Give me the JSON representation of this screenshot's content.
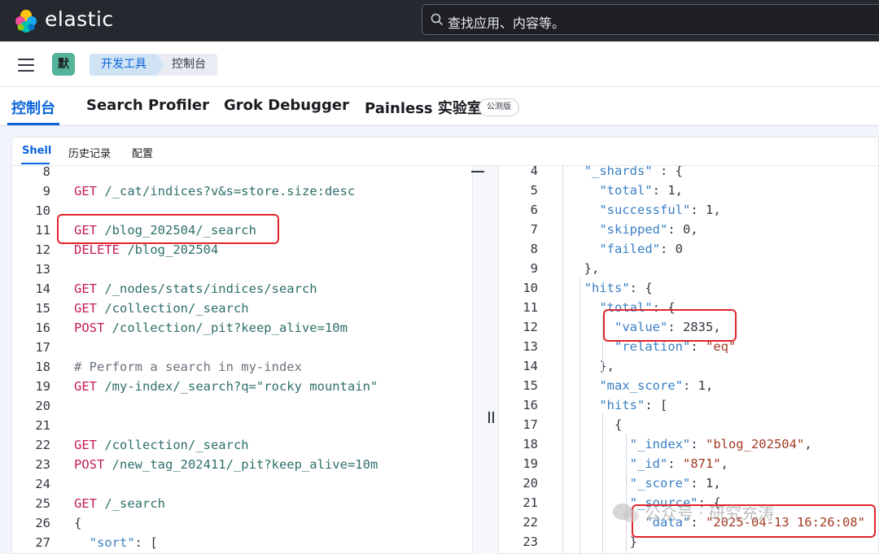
{
  "header": {
    "brand": "elastic",
    "search_placeholder": "查找应用、内容等。"
  },
  "breadcrumb": {
    "avatar_initial": "默",
    "items": [
      "开发工具",
      "控制台"
    ]
  },
  "tabs": [
    "控制台",
    "Search Profiler",
    "Grok Debugger",
    "Painless 实验室"
  ],
  "beta_badge": "公测版",
  "subtabs": [
    "Shell",
    "历史记录",
    "配置"
  ],
  "request_editor": {
    "lines": [
      {
        "n": "8",
        "parts": []
      },
      {
        "n": "9",
        "parts": [
          [
            "m",
            "GET"
          ],
          [
            "p",
            " /_cat/indices?v&s=store.size:desc"
          ]
        ]
      },
      {
        "n": "10",
        "parts": []
      },
      {
        "n": "11",
        "parts": [
          [
            "m",
            "GET"
          ],
          [
            "p",
            " /blog_202504/_search"
          ]
        ]
      },
      {
        "n": "12",
        "parts": [
          [
            "m",
            "DELETE"
          ],
          [
            "p",
            " /blog_202504"
          ]
        ]
      },
      {
        "n": "13",
        "parts": []
      },
      {
        "n": "14",
        "parts": [
          [
            "m",
            "GET"
          ],
          [
            "p",
            " /_nodes/stats/indices/search"
          ]
        ]
      },
      {
        "n": "15",
        "parts": [
          [
            "m",
            "GET"
          ],
          [
            "p",
            " /collection/_search"
          ]
        ]
      },
      {
        "n": "16",
        "parts": [
          [
            "m",
            "POST"
          ],
          [
            "p",
            " /collection/_pit?keep_alive=10m"
          ]
        ]
      },
      {
        "n": "17",
        "parts": []
      },
      {
        "n": "18",
        "parts": [
          [
            "c",
            "# Perform a search in my-index"
          ]
        ]
      },
      {
        "n": "19",
        "parts": [
          [
            "m",
            "GET"
          ],
          [
            "p",
            " /my-index/_search?q=\"rocky mountain\""
          ]
        ]
      },
      {
        "n": "20",
        "parts": []
      },
      {
        "n": "21",
        "parts": []
      },
      {
        "n": "22",
        "parts": [
          [
            "m",
            "GET"
          ],
          [
            "p",
            " /collection/_search"
          ]
        ]
      },
      {
        "n": "23",
        "parts": [
          [
            "m",
            "POST"
          ],
          [
            "p",
            " /new_tag_202411/_pit?keep_alive=10m"
          ]
        ]
      },
      {
        "n": "24",
        "parts": []
      },
      {
        "n": "25",
        "parts": [
          [
            "m",
            "GET"
          ],
          [
            "p",
            " /_search"
          ]
        ]
      },
      {
        "n": "26",
        "parts": [
          [
            "n",
            "{"
          ]
        ]
      },
      {
        "n": "27",
        "parts": [
          [
            "n",
            "  "
          ],
          [
            "k",
            "\"sort\""
          ],
          [
            "n",
            ": ["
          ]
        ]
      }
    ]
  },
  "response_editor": {
    "lines": [
      {
        "n": "4",
        "parts": [
          [
            "n",
            "  "
          ],
          [
            "k",
            "\"_shards\""
          ],
          [
            "n",
            " : {"
          ]
        ]
      },
      {
        "n": "5",
        "parts": [
          [
            "n",
            "    "
          ],
          [
            "k",
            "\"total\""
          ],
          [
            "n",
            ": "
          ],
          [
            "v",
            "1"
          ],
          [
            "n",
            ","
          ]
        ]
      },
      {
        "n": "6",
        "parts": [
          [
            "n",
            "    "
          ],
          [
            "k",
            "\"successful\""
          ],
          [
            "n",
            ": "
          ],
          [
            "v",
            "1"
          ],
          [
            "n",
            ","
          ]
        ]
      },
      {
        "n": "7",
        "parts": [
          [
            "n",
            "    "
          ],
          [
            "k",
            "\"skipped\""
          ],
          [
            "n",
            ": "
          ],
          [
            "v",
            "0"
          ],
          [
            "n",
            ","
          ]
        ]
      },
      {
        "n": "8",
        "parts": [
          [
            "n",
            "    "
          ],
          [
            "k",
            "\"failed\""
          ],
          [
            "n",
            ": "
          ],
          [
            "v",
            "0"
          ]
        ]
      },
      {
        "n": "9",
        "parts": [
          [
            "n",
            "  },"
          ]
        ]
      },
      {
        "n": "10",
        "parts": [
          [
            "n",
            "  "
          ],
          [
            "k",
            "\"hits\""
          ],
          [
            "n",
            ": {"
          ]
        ]
      },
      {
        "n": "11",
        "parts": [
          [
            "n",
            "    "
          ],
          [
            "k",
            "\"total\""
          ],
          [
            "n",
            ": {"
          ]
        ]
      },
      {
        "n": "12",
        "parts": [
          [
            "n",
            "      "
          ],
          [
            "k",
            "\"value\""
          ],
          [
            "n",
            ": "
          ],
          [
            "v",
            "2835"
          ],
          [
            "n",
            ","
          ]
        ]
      },
      {
        "n": "13",
        "parts": [
          [
            "n",
            "      "
          ],
          [
            "k",
            "\"relation\""
          ],
          [
            "n",
            ": "
          ],
          [
            "s",
            "\"eq\""
          ]
        ]
      },
      {
        "n": "14",
        "parts": [
          [
            "n",
            "    },"
          ]
        ]
      },
      {
        "n": "15",
        "parts": [
          [
            "n",
            "    "
          ],
          [
            "k",
            "\"max_score\""
          ],
          [
            "n",
            ": "
          ],
          [
            "v",
            "1"
          ],
          [
            "n",
            ","
          ]
        ]
      },
      {
        "n": "16",
        "parts": [
          [
            "n",
            "    "
          ],
          [
            "k",
            "\"hits\""
          ],
          [
            "n",
            ": ["
          ]
        ]
      },
      {
        "n": "17",
        "parts": [
          [
            "n",
            "      {"
          ]
        ]
      },
      {
        "n": "18",
        "parts": [
          [
            "n",
            "        "
          ],
          [
            "k",
            "\"_index\""
          ],
          [
            "n",
            ": "
          ],
          [
            "s",
            "\"blog_202504\""
          ],
          [
            "n",
            ","
          ]
        ]
      },
      {
        "n": "19",
        "parts": [
          [
            "n",
            "        "
          ],
          [
            "k",
            "\"_id\""
          ],
          [
            "n",
            ": "
          ],
          [
            "s",
            "\"871\""
          ],
          [
            "n",
            ","
          ]
        ]
      },
      {
        "n": "20",
        "parts": [
          [
            "n",
            "        "
          ],
          [
            "k",
            "\"_score\""
          ],
          [
            "n",
            ": "
          ],
          [
            "v",
            "1"
          ],
          [
            "n",
            ","
          ]
        ]
      },
      {
        "n": "21",
        "parts": [
          [
            "n",
            "        "
          ],
          [
            "k",
            "\"_source\""
          ],
          [
            "n",
            ": {"
          ]
        ]
      },
      {
        "n": "22",
        "parts": [
          [
            "n",
            "          "
          ],
          [
            "k",
            "\"data\""
          ],
          [
            "n",
            ": "
          ],
          [
            "s",
            "\"2025-04-13 16:26:08\""
          ]
        ]
      },
      {
        "n": "23",
        "parts": [
          [
            "n",
            "        }"
          ]
        ]
      }
    ]
  },
  "watermark": "公众号 · 研究充涛",
  "colors": {
    "accent": "#0b64dd",
    "annotation": "#e2252b",
    "topbar": "#25282f"
  }
}
